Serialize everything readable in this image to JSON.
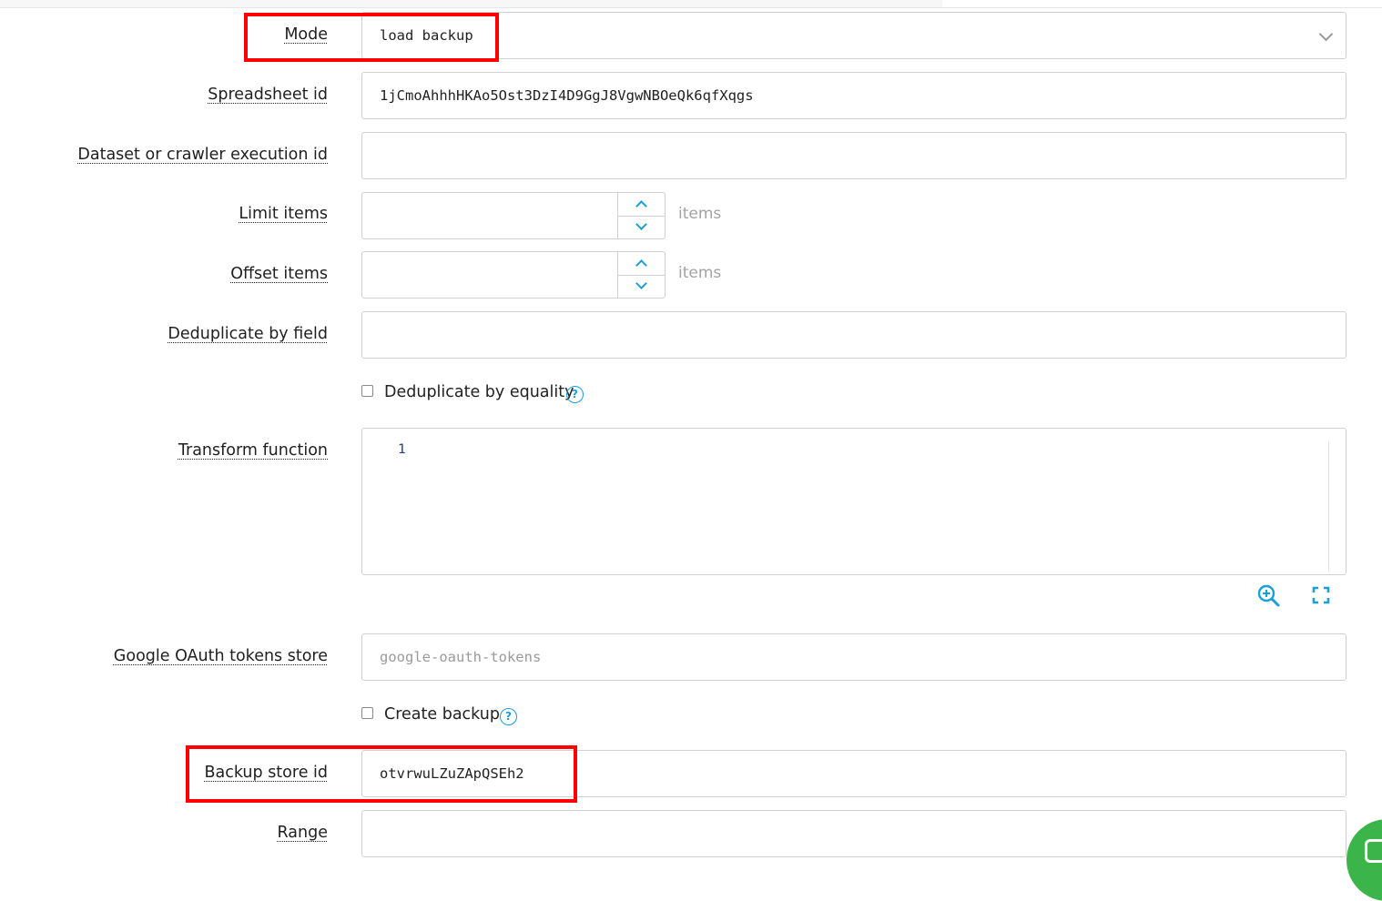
{
  "form": {
    "mode": {
      "label": "Mode",
      "value": "load backup"
    },
    "spreadsheet_id": {
      "label": "Spreadsheet id",
      "value": "1jCmoAhhhHKAo5Ost3DzI4D9GgJ8VgwNBOeQk6qfXqgs"
    },
    "dataset_id": {
      "label": "Dataset or crawler execution id",
      "value": ""
    },
    "limit_items": {
      "label": "Limit items",
      "value": "",
      "unit": "items"
    },
    "offset_items": {
      "label": "Offset items",
      "value": "",
      "unit": "items"
    },
    "deduplicate_field": {
      "label": "Deduplicate by field",
      "value": ""
    },
    "deduplicate_equality": {
      "label": "Deduplicate by equality",
      "checked": false
    },
    "transform_function": {
      "label": "Transform function",
      "line_number": "1"
    },
    "google_oauth_store": {
      "label": "Google OAuth tokens store",
      "placeholder": "google-oauth-tokens"
    },
    "create_backup": {
      "label": "Create backup",
      "checked": false
    },
    "backup_store_id": {
      "label": "Backup store id",
      "value": "otvrwuLZuZApQSEh2"
    },
    "range": {
      "label": "Range",
      "value": ""
    }
  },
  "icons": {
    "help": "question-circle-icon",
    "zoom": "zoom-in-icon",
    "fullscreen": "fullscreen-icon",
    "spinner_up": "chevron-up-icon",
    "spinner_down": "chevron-down-icon",
    "chat": "chat-icon"
  },
  "colors": {
    "accent": "#1a9fd8",
    "highlight": "#ff0000",
    "chat": "#3bb54a"
  }
}
